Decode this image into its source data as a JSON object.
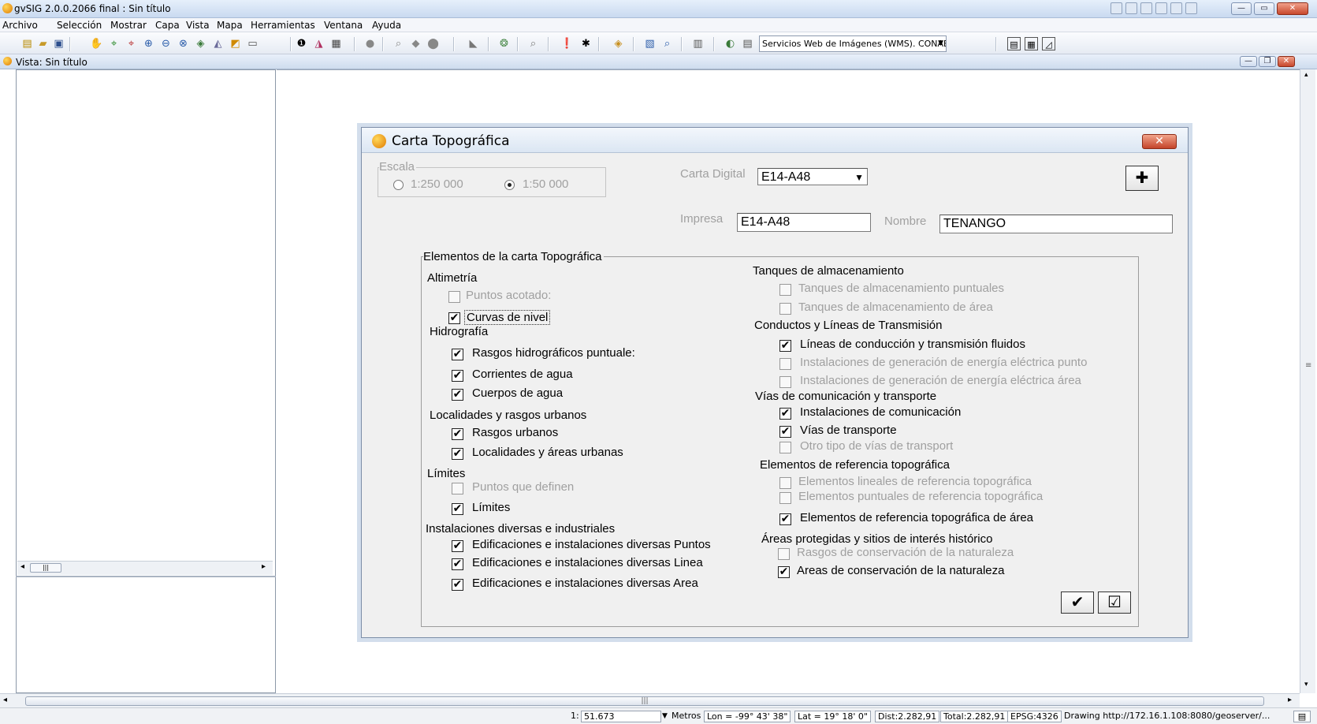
{
  "app": {
    "title": "gvSIG 2.0.0.2066 final : Sin título"
  },
  "menubar": {
    "items": [
      "Archivo",
      "Selección",
      "Mostrar",
      "Capa",
      "Vista",
      "Mapa",
      "Herramientas",
      "Ventana",
      "Ayuda"
    ]
  },
  "toolbar": {
    "wms_selected": "Servicios Web de Imágenes (WMS). CONABIO"
  },
  "view": {
    "title": "Vista: Sin título"
  },
  "dialog": {
    "title": "Carta Topográfica",
    "escala": {
      "label": "Escala",
      "options": [
        "1:250 000",
        "1:50 000"
      ],
      "selected": "1:50 000"
    },
    "carta_digital": {
      "label": "Carta Digital",
      "value": "E14-A48"
    },
    "impresa": {
      "label": "Impresa",
      "value": "E14-A48"
    },
    "nombre": {
      "label": "Nombre",
      "value": "TENANGO"
    },
    "group_title": "Elementos de la carta Topográfica",
    "left": {
      "altimetria": {
        "title": "Altimetría",
        "items": [
          {
            "label": "Puntos acotado:",
            "checked": false,
            "enabled": false
          },
          {
            "label": "Curvas de nivel",
            "checked": true,
            "enabled": true
          }
        ]
      },
      "hidrografia": {
        "title": "Hidrografía",
        "items": [
          {
            "label": "Rasgos hidrográficos puntuale:",
            "checked": true,
            "enabled": true
          },
          {
            "label": "Corrientes de agua",
            "checked": true,
            "enabled": true
          },
          {
            "label": "Cuerpos de agua",
            "checked": true,
            "enabled": true
          }
        ]
      },
      "localidades": {
        "title": "Localidades y rasgos urbanos",
        "items": [
          {
            "label": "Rasgos urbanos",
            "checked": true,
            "enabled": true
          },
          {
            "label": "Localidades y áreas urbanas",
            "checked": true,
            "enabled": true
          }
        ]
      },
      "limites": {
        "title": "Límites",
        "items": [
          {
            "label": "Puntos que definen",
            "checked": false,
            "enabled": false
          },
          {
            "label": "Límites",
            "checked": true,
            "enabled": true
          }
        ]
      },
      "instalaciones": {
        "title": "Instalaciones diversas e industriales",
        "items": [
          {
            "label": "Edificaciones e instalaciones diversas  Puntos",
            "checked": true,
            "enabled": true
          },
          {
            "label": "Edificaciones e instalaciones diversas Linea",
            "checked": true,
            "enabled": true
          },
          {
            "label": "Edificaciones e instalaciones diversas Area",
            "checked": true,
            "enabled": true
          }
        ]
      }
    },
    "right": {
      "tanques": {
        "title": "Tanques de almacenamiento",
        "items": [
          {
            "label": "Tanques de almacenamiento puntuales",
            "checked": false,
            "enabled": false
          },
          {
            "label": "Tanques de almacenamiento de área",
            "checked": false,
            "enabled": false
          }
        ]
      },
      "conductos": {
        "title": "Conductos y Líneas de Transmisión",
        "items": [
          {
            "label": "Líneas de conducción y transmisión fluidos",
            "checked": true,
            "enabled": true
          },
          {
            "label": "Instalaciones de generación de energía  eléctrica punto",
            "checked": false,
            "enabled": false
          },
          {
            "label": "Instalaciones de generación de energía  eléctrica área",
            "checked": false,
            "enabled": false
          }
        ]
      },
      "vias": {
        "title": "Vías de comunicación y transporte",
        "items": [
          {
            "label": "Instalaciones de comunicación",
            "checked": true,
            "enabled": true
          },
          {
            "label": "Vías de transporte",
            "checked": true,
            "enabled": true
          },
          {
            "label": "Otro tipo de vías de transport",
            "checked": false,
            "enabled": false
          }
        ]
      },
      "referencia": {
        "title": "Elementos de referencia topográfica",
        "items": [
          {
            "label": "Elementos lineales de referencia topográfica",
            "checked": false,
            "enabled": false
          },
          {
            "label": "Elementos puntuales de referencia topográfica",
            "checked": false,
            "enabled": false
          },
          {
            "label": "Elementos de referencia topográfica de área",
            "checked": true,
            "enabled": true
          }
        ]
      },
      "areas": {
        "title": "Áreas protegidas y sitios de interés histórico",
        "items": [
          {
            "label": "Rasgos de conservación de la naturaleza",
            "checked": false,
            "enabled": false
          },
          {
            "label": "Areas de conservación de la naturaleza",
            "checked": true,
            "enabled": true
          }
        ]
      }
    }
  },
  "statusbar": {
    "scale_prefix": "1:",
    "scale": "51.673",
    "units": "Metros",
    "lon": "Lon = -99° 43' 38\"",
    "lat": "Lat = 19° 18' 0\"",
    "dist": "Dist:2.282,91",
    "total": "Total:2.282,91",
    "epsg": "EPSG:4326",
    "drawing": "Drawing http://172.16.1.108:8080/geoserver/..."
  },
  "icons": {
    "check_mark": "✔",
    "unchecked_mark": ""
  }
}
